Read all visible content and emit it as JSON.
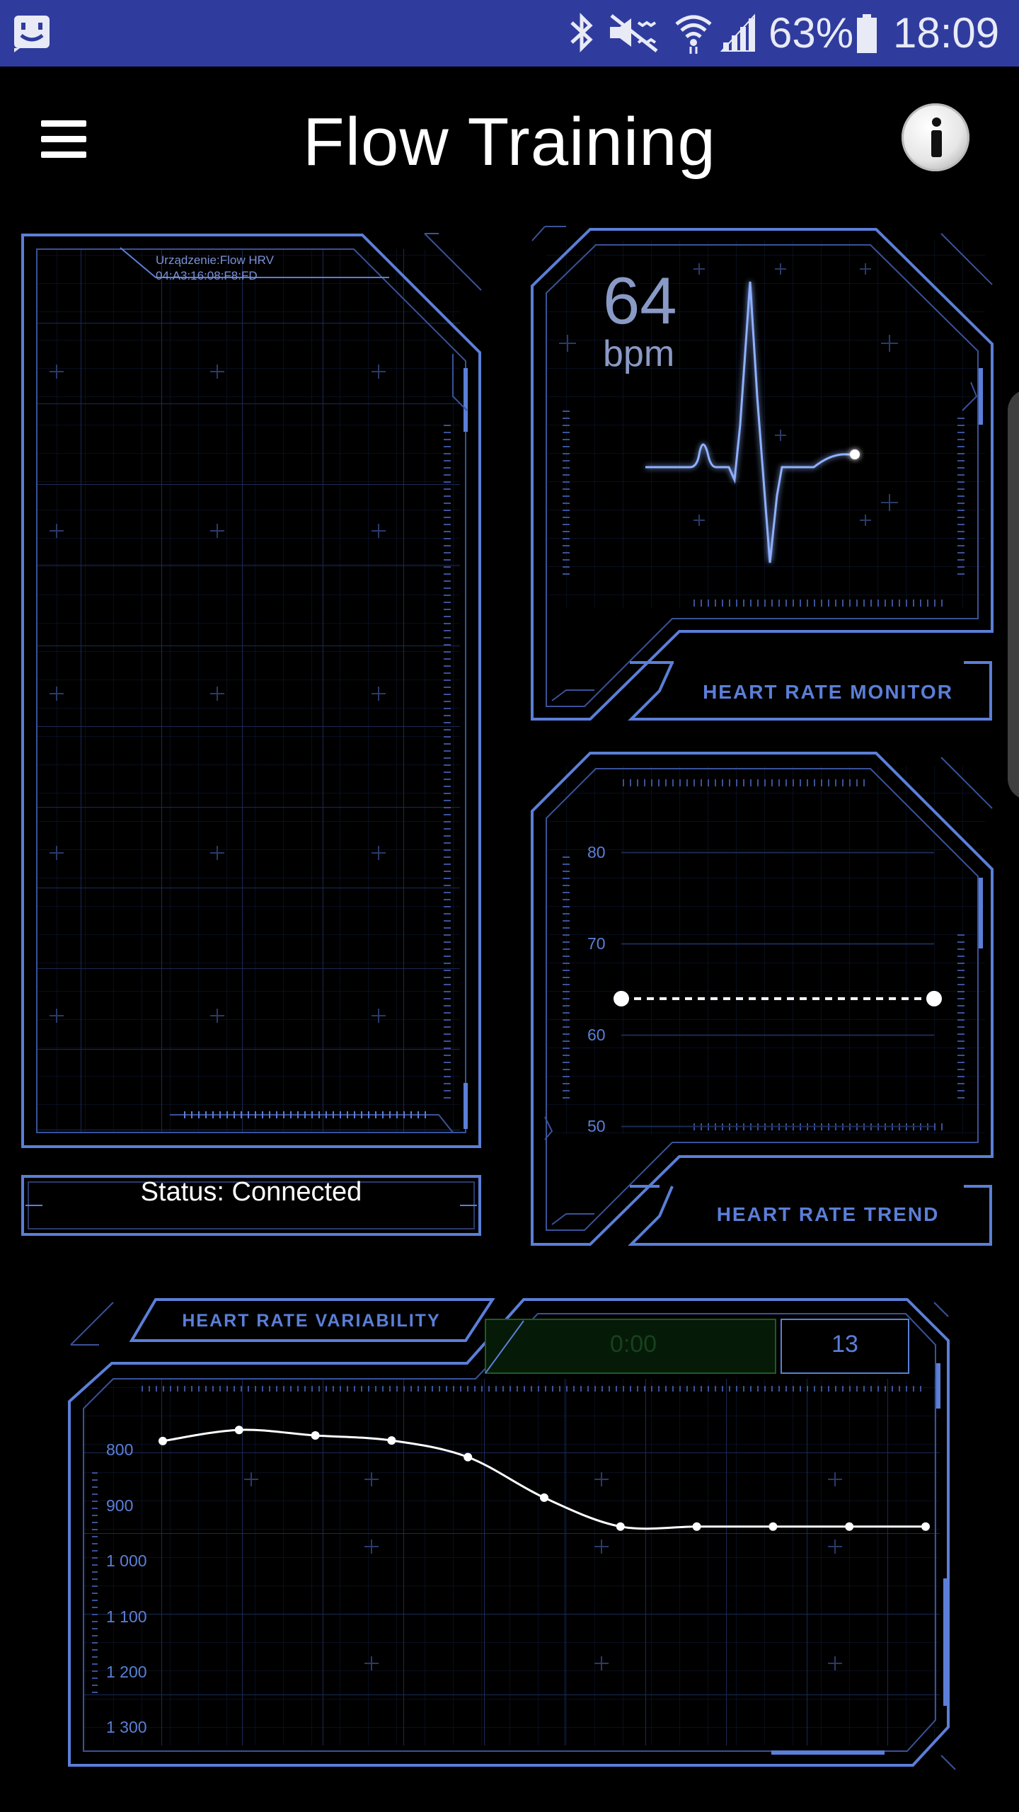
{
  "status_bar": {
    "battery_percent": "63%",
    "time": "18:09",
    "icons": [
      "notification-face-icon",
      "bluetooth-icon",
      "mute-icon",
      "wifi-icon",
      "signal-icon",
      "battery-icon"
    ]
  },
  "app_bar": {
    "title": "Flow Training",
    "menu_icon": "hamburger-menu-icon",
    "info_icon": "info-icon"
  },
  "device_panel": {
    "device_line1": "Urządzenie:Flow HRV",
    "device_line2": "04:A3:16:08:F8:FD",
    "status": "Status: Connected"
  },
  "heart_rate_monitor": {
    "value": "64",
    "unit": "bpm",
    "label": "HEART RATE MONITOR"
  },
  "heart_rate_trend": {
    "label": "HEART RATE TREND",
    "chart_data": {
      "type": "line",
      "yticks": [
        80,
        70,
        60,
        50
      ],
      "ylim": [
        45,
        85
      ],
      "x": [
        0,
        1
      ],
      "values": [
        64,
        64
      ]
    }
  },
  "heart_rate_variability": {
    "label": "HEART RATE VARIABILITY",
    "timer": "0:00",
    "count": "13",
    "chart_data": {
      "type": "line",
      "yticks": [
        "800",
        "900",
        "1 000",
        "1 100",
        "1 200",
        "1 300"
      ],
      "ylim": [
        750,
        1330
      ],
      "y_inverted": true,
      "x": [
        0,
        1,
        2,
        3,
        4,
        5,
        6,
        7,
        8,
        9,
        10
      ],
      "values": [
        783,
        763,
        773,
        782,
        812,
        885,
        937,
        937,
        937,
        937,
        937
      ]
    }
  },
  "colors": {
    "accent": "#5b7fd8",
    "statusbar": "#2f3c9e",
    "grid": "#1b2a55",
    "background": "#000000"
  }
}
